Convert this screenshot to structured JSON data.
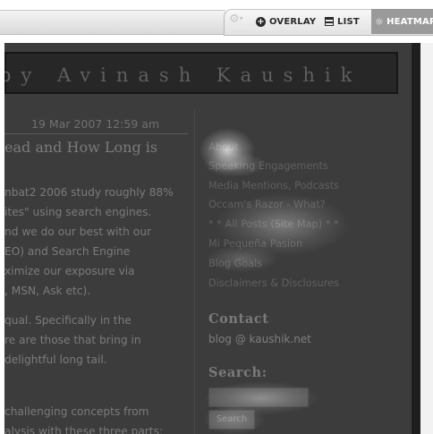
{
  "toolbar": {
    "settings_icon": "gear-icon",
    "overlay_label": "OVERLAY",
    "list_label": "LIST",
    "heatmap_label": "HEATMAP",
    "active_tab": "HEATMAP"
  },
  "page": {
    "banner_title": "by Avinash Kaushik",
    "post": {
      "date": "19 Mar 2007 12:59 am",
      "title": "ead and How Long is",
      "paragraph1": [
        "nbat2 2006 study roughly 88%",
        "ites\" using search engines.",
        "nd we do our best with our",
        "EO) and Search Engine",
        "ximize our exposure via",
        ", MSN, Ask etc)."
      ],
      "paragraph2": [
        "qual. Specifically in the",
        "re are those that bring in",
        " delightful long tail."
      ],
      "paragraph3": [
        "challenging concepts from",
        "alysis with these three parts:"
      ]
    },
    "sidebar": {
      "links": [
        "About",
        "Speaking Engagements",
        "Media Mentions, Podcasts",
        "Occam's Razor - What?",
        "* * All Posts (Site Map) * *",
        "Mi Pequeña Pasion",
        "Blog Goals",
        "Disclaimers & Disclosures"
      ],
      "contact_heading": "Contact",
      "contact_email": "blog @ kaushik.net",
      "search_heading": "Search:",
      "search_value": "",
      "search_button": "Search"
    }
  },
  "colors": {
    "page_dim": "#3c3c3c",
    "heatmap_tab": "#9a9a9a",
    "heat_spot": "#ffffff"
  }
}
